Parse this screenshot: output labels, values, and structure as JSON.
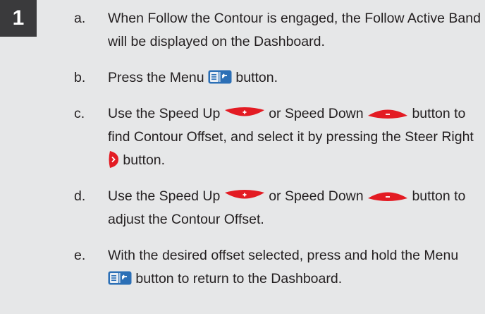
{
  "step_number": "1",
  "steps": [
    {
      "letter": "a.",
      "text": "When Follow the Contour is engaged, the Follow Active Band will be displayed on the Dashboard."
    },
    {
      "letter": "b.",
      "p1": "Press the Menu ",
      "p2": " button."
    },
    {
      "letter": "c.",
      "p1": "Use the Speed Up ",
      "p2": " or Speed Down ",
      "p3": " button to find Contour Offset, and select it by pressing the Steer Right ",
      "p4": " button."
    },
    {
      "letter": "d.",
      "p1": "Use the Speed Up ",
      "p2": " or Speed Down ",
      "p3": " button to adjust the Contour Offset."
    },
    {
      "letter": "e.",
      "p1": "With the desired offset selected, press and hold the Menu ",
      "p2": " button to return to the Dashboard."
    }
  ],
  "icons": {
    "menu_button": "menu-button-icon",
    "speed_up_button": "speed-up-button-icon",
    "speed_down_button": "speed-down-button-icon",
    "steer_right_button": "steer-right-button-icon"
  },
  "colors": {
    "page_background": "#e6e7e8",
    "badge_background": "#3a3a3c",
    "button_red": "#e31b23",
    "button_blue": "#2b6fb6",
    "text": "#231f20"
  }
}
